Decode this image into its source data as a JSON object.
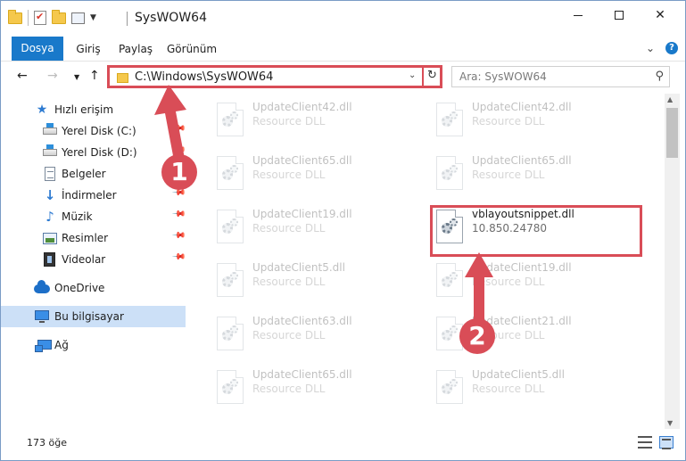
{
  "window": {
    "title": "SysWOW64",
    "controls": {
      "minimize": "—",
      "maximize": "☐",
      "close": "✕"
    }
  },
  "ribbon": {
    "tabs": [
      "Dosya",
      "Giriş",
      "Paylaş",
      "Görünüm"
    ],
    "expand": "⌄",
    "help": "?"
  },
  "nav": {
    "back": "←",
    "forward": "→",
    "recent": "▼",
    "up": "↑"
  },
  "address": {
    "path": "C:\\Windows\\SysWOW64",
    "dropdown": "⌄",
    "refresh": "↻"
  },
  "search": {
    "placeholder": "Ara: SysWOW64",
    "icon": "⚲"
  },
  "sidebar": {
    "items": [
      {
        "label": "Hızlı erişim",
        "icon": "star-icon"
      },
      {
        "label": "Yerel Disk (C:)",
        "icon": "drive-icon",
        "pinned": true
      },
      {
        "label": "Yerel Disk (D:)",
        "icon": "drive-icon",
        "pinned": true
      },
      {
        "label": "Belgeler",
        "icon": "documents-icon",
        "pinned": true
      },
      {
        "label": "İndirmeler",
        "icon": "download-icon",
        "pinned": true
      },
      {
        "label": "Müzik",
        "icon": "music-icon",
        "pinned": true
      },
      {
        "label": "Resimler",
        "icon": "pictures-icon",
        "pinned": true
      },
      {
        "label": "Videolar",
        "icon": "videos-icon",
        "pinned": true
      },
      {
        "label": "OneDrive",
        "icon": "onedrive-icon"
      },
      {
        "label": "Bu bilgisayar",
        "icon": "computer-icon",
        "selected": true
      },
      {
        "label": "Ağ",
        "icon": "network-icon"
      }
    ]
  },
  "files": [
    {
      "name": "UpdateClient42.dll",
      "sub": "Resource DLL"
    },
    {
      "name": "UpdateClient42.dll",
      "sub": "Resource DLL"
    },
    {
      "name": "UpdateClient65.dll",
      "sub": "Resource DLL"
    },
    {
      "name": "UpdateClient65.dll",
      "sub": "Resource DLL"
    },
    {
      "name": "UpdateClient19.dll",
      "sub": "Resource DLL"
    },
    {
      "name": "vblayoutsnippet.dll",
      "sub": "10.850.24780",
      "highlighted": true
    },
    {
      "name": "UpdateClient5.dll",
      "sub": "Resource DLL"
    },
    {
      "name": "UpdateClient19.dll",
      "sub": "Resource DLL"
    },
    {
      "name": "UpdateClient63.dll",
      "sub": "Resource DLL"
    },
    {
      "name": "UpdateClient21.dll",
      "sub": "Resource DLL"
    },
    {
      "name": "UpdateClient65.dll",
      "sub": "Resource DLL"
    },
    {
      "name": "UpdateClient5.dll",
      "sub": "Resource DLL"
    }
  ],
  "status": {
    "item_count": "173 öğe"
  },
  "annotations": {
    "step1": "1",
    "step2": "2",
    "color": "#d94d57"
  },
  "colors": {
    "accent": "#1979ca",
    "selection": "#cce0f7",
    "annotation": "#d94d57"
  }
}
